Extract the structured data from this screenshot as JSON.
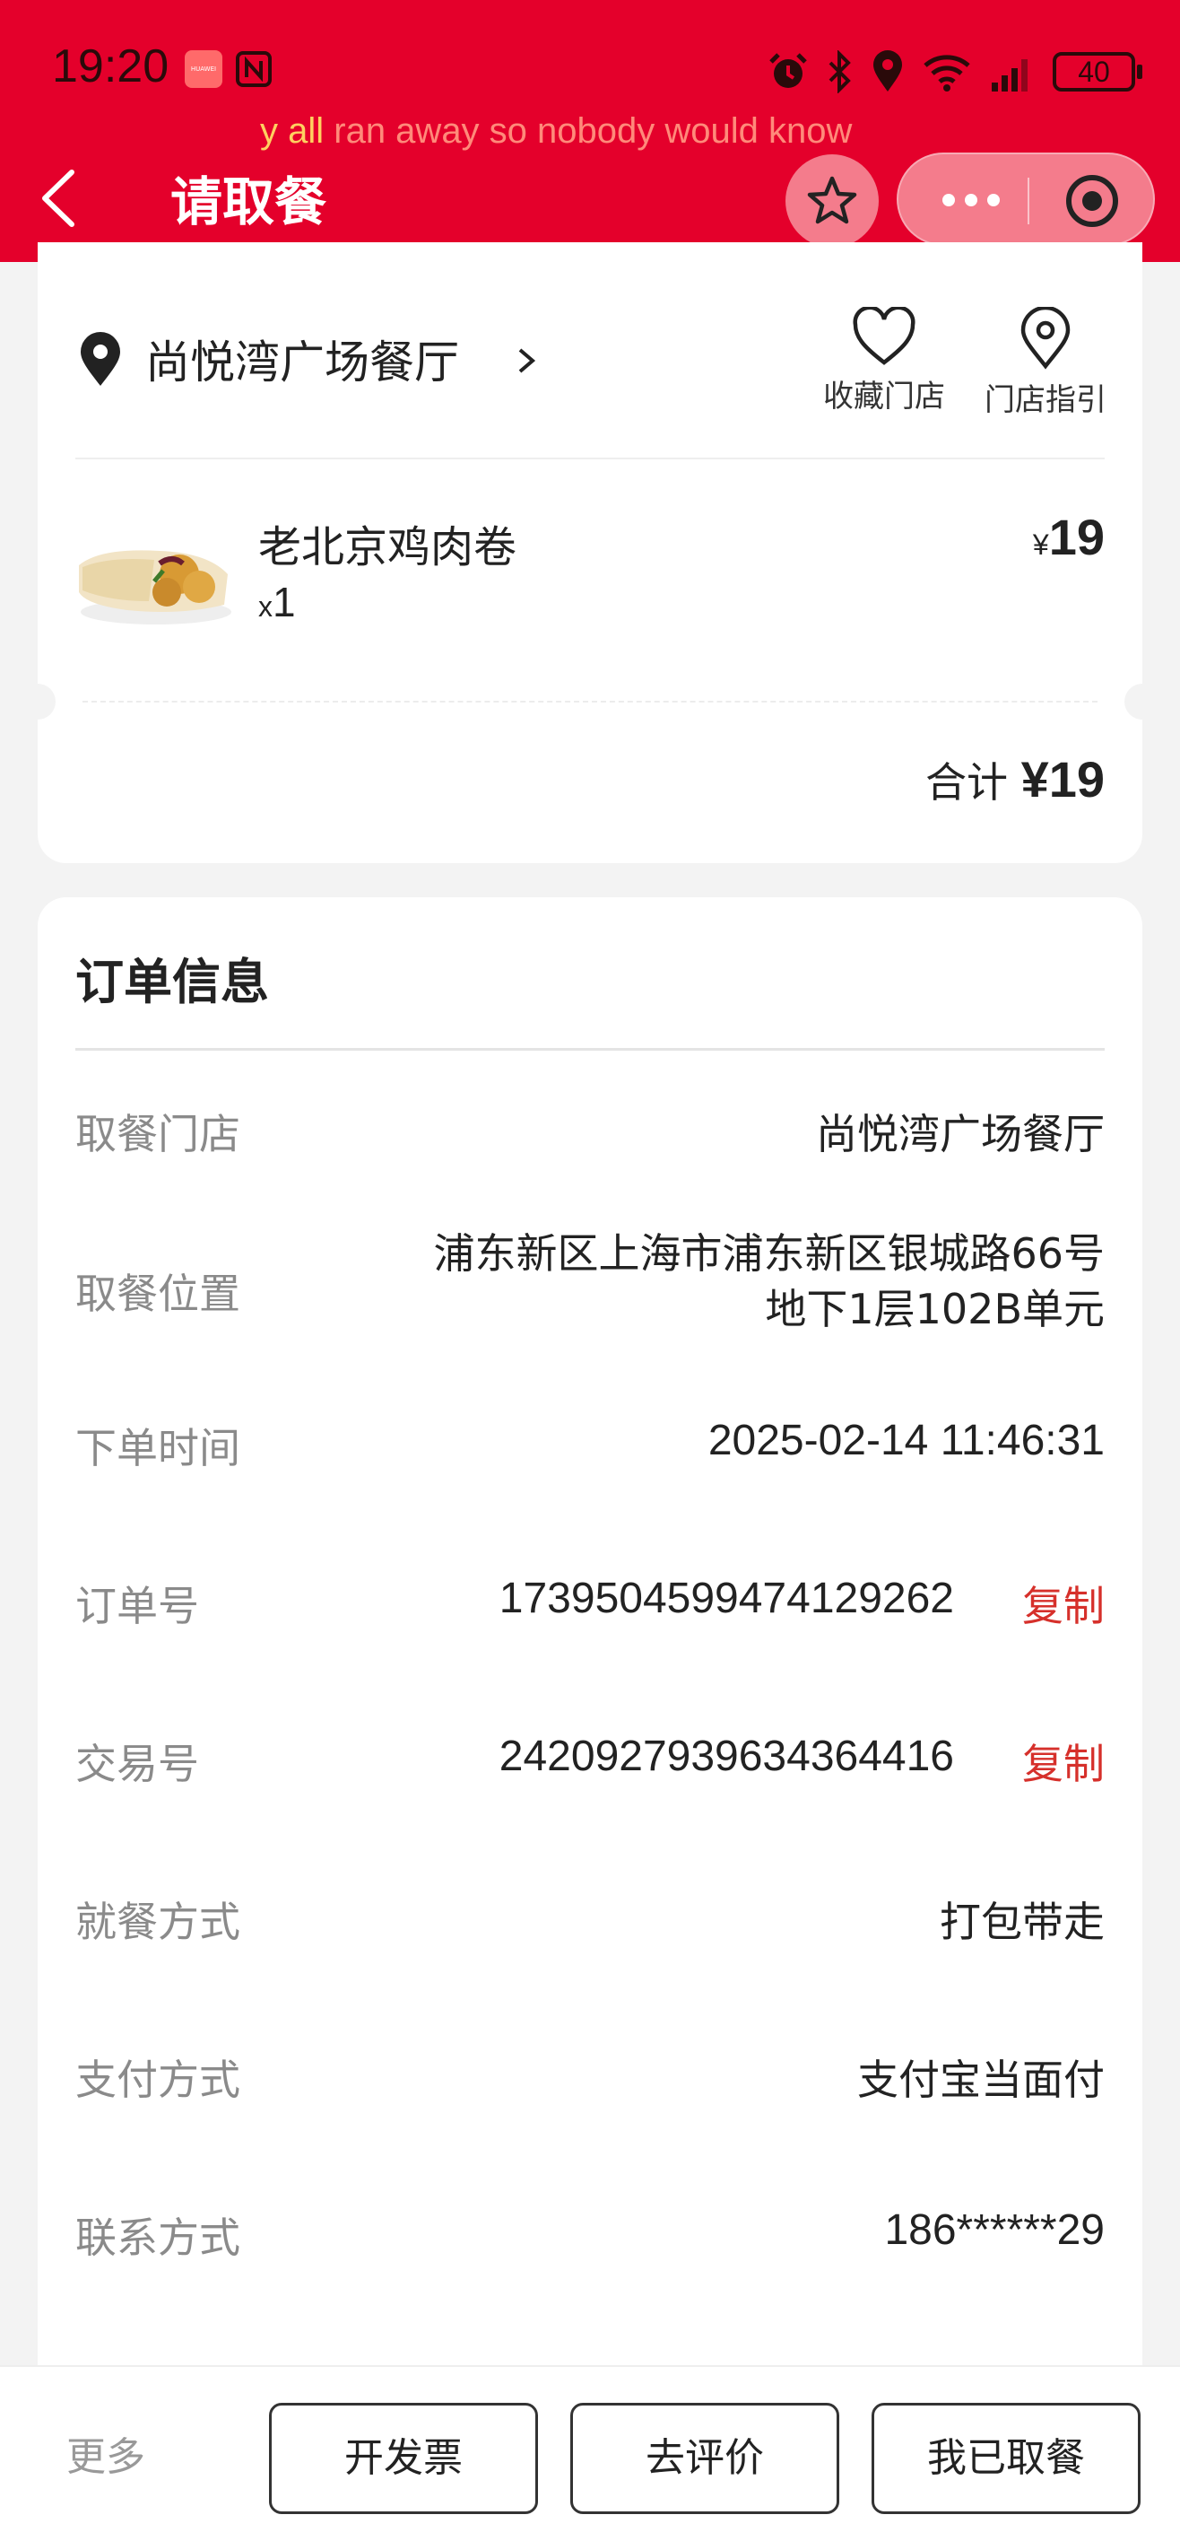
{
  "status_bar": {
    "time": "19:20",
    "brand_badge": "HUAWEI",
    "battery": "40"
  },
  "header": {
    "marquee_highlight": "y all",
    "marquee_text": " ran away so nobody would know",
    "title": "请取餐"
  },
  "store": {
    "name": "尚悦湾广场餐厅",
    "favorite_label": "收藏门店",
    "guide_label": "门店指引"
  },
  "item": {
    "name": "老北京鸡肉卷",
    "qty_prefix": "x",
    "qty": "1",
    "currency": "¥",
    "price": "19"
  },
  "total": {
    "label": "合计 ",
    "amount": "¥19"
  },
  "order_info": {
    "title": "订单信息",
    "rows": [
      {
        "key": "取餐门店",
        "value": "尚悦湾广场餐厅"
      },
      {
        "key": "取餐位置",
        "value_line1": "浦东新区上海市浦东新区银城路66号",
        "value_line2": "地下1层102B单元"
      },
      {
        "key": "下单时间",
        "value": "2025-02-14 11:46:31"
      },
      {
        "key": "订单号",
        "value": "1739504599474129262",
        "action": "复制"
      },
      {
        "key": "交易号",
        "value": "2420927939634364416",
        "action": "复制"
      },
      {
        "key": "就餐方式",
        "value": "打包带走"
      },
      {
        "key": "支付方式",
        "value": "支付宝当面付"
      },
      {
        "key": "联系方式",
        "value": "186******29"
      }
    ]
  },
  "bottom_bar": {
    "more": "更多",
    "invoice": "开发票",
    "review": "去评价",
    "picked_up": "我已取餐"
  },
  "colors": {
    "brand_red": "#e4002b",
    "copy_red": "#d6302b"
  }
}
